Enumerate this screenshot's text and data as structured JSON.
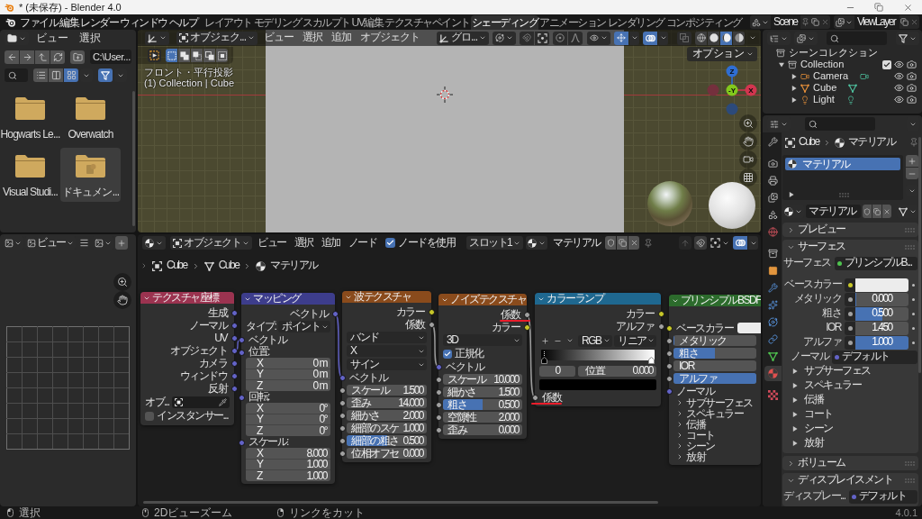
{
  "window": {
    "title": "* (未保存) - Blender 4.0"
  },
  "top_bar": {
    "menus": [
      "ファイル",
      "編集",
      "レンダー",
      "ウィンドウ",
      "ヘルプ"
    ],
    "workspaces": [
      {
        "label": "レイアウト",
        "selected": false
      },
      {
        "label": "モデリング",
        "selected": false
      },
      {
        "label": "スカルプト",
        "selected": false
      },
      {
        "label": "UV編集",
        "selected": false
      },
      {
        "label": "テクスチャペイント",
        "selected": false
      },
      {
        "label": "シェーディング",
        "selected": true
      },
      {
        "label": "アニメーション",
        "selected": false
      },
      {
        "label": "レンダリング",
        "selected": false
      },
      {
        "label": "コンポジティング",
        "selected": false
      }
    ],
    "scene": "Scene",
    "view_layer": "ViewLayer"
  },
  "file_browser": {
    "menus": [
      "ビュー",
      "選択"
    ],
    "path": "C:\\User...",
    "display_modes": [
      {
        "kind": "list",
        "selected": false
      },
      {
        "kind": "columns",
        "selected": false
      },
      {
        "kind": "thumbnails",
        "selected": true
      }
    ],
    "filter": {
      "on": true
    },
    "items": [
      {
        "name": "Hogwarts Le...",
        "kind": "folder",
        "selected": false
      },
      {
        "name": "Overwatch",
        "kind": "folder",
        "selected": false
      },
      {
        "name": "Visual Studi...",
        "kind": "folder",
        "selected": false
      },
      {
        "name": "ドキュメン...",
        "kind": "documents",
        "selected": true
      }
    ]
  },
  "viewport": {
    "mode": "オブジェク...",
    "menus": [
      "ビュー",
      "選択",
      "追加",
      "オブジェクト"
    ],
    "orientation": "グロ...",
    "toggles": [
      {
        "kind": "gizmos",
        "on": true
      },
      {
        "kind": "overlays",
        "on": true
      },
      {
        "kind": "xray",
        "on": false
      }
    ],
    "shading_modes": [
      {
        "kind": "wireframe",
        "selected": false
      },
      {
        "kind": "solid",
        "selected": false
      },
      {
        "kind": "material",
        "selected": true
      },
      {
        "kind": "rendered",
        "selected": false
      }
    ],
    "select_modes": [
      {
        "kind": "set",
        "selected": true
      },
      {
        "kind": "extend",
        "selected": false
      },
      {
        "kind": "subtract",
        "selected": false
      },
      {
        "kind": "invert",
        "selected": false
      },
      {
        "kind": "intersect",
        "selected": false
      }
    ],
    "view_name": "フロント・平行投影",
    "collection_info": "(1) Collection | Cube",
    "options": "オプション",
    "gizmo": {
      "z": "Z",
      "y": "-Y",
      "x": "X"
    }
  },
  "outliner": {
    "items": [
      {
        "name": "シーンコレクション",
        "kind": "scene",
        "children": [
          {
            "name": "Collection",
            "kind": "collection",
            "expanded": true,
            "checked": true,
            "children": [
              {
                "name": "Camera",
                "kind": "camera",
                "expanded": false
              },
              {
                "name": "Cube",
                "kind": "mesh",
                "expanded": false
              },
              {
                "name": "Light",
                "kind": "light",
                "expanded": false
              }
            ]
          }
        ]
      }
    ]
  },
  "properties": {
    "tabs": [
      {
        "kind": "tool",
        "selected": false
      },
      {
        "kind": "render",
        "selected": false
      },
      {
        "kind": "output",
        "selected": false
      },
      {
        "kind": "view_layer",
        "selected": false
      },
      {
        "kind": "scene",
        "selected": false
      },
      {
        "kind": "world",
        "selected": false
      },
      {
        "kind": "collection",
        "selected": false
      },
      {
        "kind": "object",
        "selected": false
      },
      {
        "kind": "modifiers",
        "selected": false
      },
      {
        "kind": "particles",
        "selected": false
      },
      {
        "kind": "physics",
        "selected": false
      },
      {
        "kind": "constraints",
        "selected": false
      },
      {
        "kind": "data",
        "selected": false
      },
      {
        "kind": "material",
        "selected": true
      },
      {
        "kind": "texture",
        "selected": false
      }
    ],
    "breadcrumbs": [
      {
        "kind": "object",
        "label": "Cube"
      },
      {
        "kind": "material",
        "label": "マテリアル"
      }
    ],
    "slots": [
      {
        "name": "マテリアル",
        "selected": true
      }
    ],
    "material": "マテリアル",
    "panels": [
      {
        "title": "プレビュー",
        "expanded": false
      },
      {
        "title": "サーフェス",
        "expanded": true,
        "rows": [
          {
            "kind": "link",
            "label": "サーフェス",
            "value": "プリンシプルB...",
            "socket": {
              "color": "#4fc34f"
            }
          },
          {
            "kind": "color",
            "label": "ベースカラー",
            "socket": {
              "color": "#c7c729"
            },
            "color": "#ececec"
          },
          {
            "kind": "slider",
            "label": "メタリック",
            "value": "0.000",
            "socket": {
              "color": "#a1a1a1"
            },
            "level": 0
          },
          {
            "kind": "slider",
            "label": "粗さ",
            "value": "0.500",
            "socket": {
              "color": "#a1a1a1"
            },
            "level": 0.5
          },
          {
            "kind": "number",
            "label": "IOR",
            "value": "1.450",
            "socket": {
              "color": "#a1a1a1"
            }
          },
          {
            "kind": "slider",
            "label": "アルファ",
            "value": "1.000",
            "socket": {
              "color": "#a1a1a1"
            },
            "level": 1
          },
          {
            "kind": "link",
            "label": "ノーマル",
            "value": "デフォルト",
            "socket": {
              "color": "#6363c7"
            }
          },
          {
            "kind": "subpanel",
            "label": "サブサーフェス",
            "expanded": false
          },
          {
            "kind": "subpanel",
            "label": "スペキュラー",
            "expanded": false
          },
          {
            "kind": "subpanel",
            "label": "伝播",
            "expanded": false
          },
          {
            "kind": "subpanel",
            "label": "コート",
            "expanded": false
          },
          {
            "kind": "subpanel",
            "label": "シーン",
            "expanded": false
          },
          {
            "kind": "subpanel",
            "label": "放射",
            "expanded": false
          }
        ]
      },
      {
        "title": "ボリューム",
        "expanded": false
      },
      {
        "title": "ディスプレイスメント",
        "expanded": true,
        "rows": [
          {
            "kind": "link",
            "label": "ディスプレー...",
            "value": "デフォルト",
            "socket": {
              "color": "#6363c7"
            }
          }
        ]
      }
    ]
  },
  "image_editor": {
    "view_menu": "ビュー"
  },
  "node_editor": {
    "object_mode": "オブジェクト",
    "menus": [
      "ビュー",
      "選択",
      "追加",
      "ノード"
    ],
    "use_nodes": {
      "label": "ノードを使用",
      "checked": true
    },
    "slot": "スロット1",
    "material": "マテリアル",
    "overlays": {
      "on": true
    },
    "breadcrumbs": [
      {
        "kind": "object",
        "label": "Cube"
      },
      {
        "kind": "mesh",
        "label": "Cube"
      },
      {
        "kind": "material",
        "label": "マテリアル"
      }
    ],
    "nodes": [
      {
        "title": "テクスチャ座標",
        "color": "#9b3350",
        "rows": [
          {
            "kind": "output",
            "label": "生成",
            "socket": {
              "color": "#6363c7"
            }
          },
          {
            "kind": "output",
            "label": "ノーマル",
            "socket": {
              "color": "#6363c7"
            }
          },
          {
            "kind": "output",
            "label": "UV",
            "socket": {
              "color": "#6363c7"
            }
          },
          {
            "kind": "output",
            "label": "オブジェクト",
            "socket": {
              "color": "#6363c7"
            }
          },
          {
            "kind": "output",
            "label": "カメラ",
            "socket": {
              "color": "#6363c7"
            }
          },
          {
            "kind": "output",
            "label": "ウィンドウ",
            "socket": {
              "color": "#6363c7"
            }
          },
          {
            "kind": "output",
            "label": "反射",
            "socket": {
              "color": "#6363c7"
            }
          },
          {
            "kind": "object",
            "label": "オブ..."
          },
          {
            "kind": "checkbox",
            "label": "インスタンサー...",
            "checked": false
          }
        ]
      },
      {
        "title": "マッピング",
        "color": "#3d3d8c",
        "rows": [
          {
            "kind": "output",
            "label": "ベクトル",
            "socket": {
              "color": "#6363c7"
            }
          },
          {
            "kind": "dropdown",
            "label": "タイプ:",
            "value": "ポイント"
          },
          {
            "kind": "input",
            "label": "ベクトル",
            "socket": {
              "color": "#6363c7"
            }
          },
          {
            "kind": "vector",
            "label": "位置:",
            "socket": {
              "color": "#6363c7"
            },
            "components": [
              {
                "axis": "X",
                "value": "0 m"
              },
              {
                "axis": "Y",
                "value": "0 m"
              },
              {
                "axis": "Z",
                "value": "0 m"
              }
            ]
          },
          {
            "kind": "vector",
            "label": "回転:",
            "socket": {
              "color": "#6363c7"
            },
            "components": [
              {
                "axis": "X",
                "value": "0°"
              },
              {
                "axis": "Y",
                "value": "0°"
              },
              {
                "axis": "Z",
                "value": "0°"
              }
            ]
          },
          {
            "kind": "vector",
            "label": "スケール:",
            "socket": {
              "color": "#6363c7"
            },
            "components": [
              {
                "axis": "X",
                "value": "8.000"
              },
              {
                "axis": "Y",
                "value": "1.000"
              },
              {
                "axis": "Z",
                "value": "1.000"
              }
            ]
          }
        ]
      },
      {
        "title": "波テクスチャ",
        "color": "#8a4b1c",
        "rows": [
          {
            "kind": "output",
            "label": "カラー",
            "socket": {
              "color": "#c7c729"
            }
          },
          {
            "kind": "output",
            "label": "係数",
            "socket": {
              "color": "#a1a1a1"
            }
          },
          {
            "kind": "dropdown",
            "value": "バンド"
          },
          {
            "kind": "dropdown",
            "value": "X"
          },
          {
            "kind": "dropdown",
            "value": "サイン"
          },
          {
            "kind": "input",
            "label": "ベクトル",
            "socket": {
              "color": "#6363c7"
            }
          },
          {
            "kind": "number",
            "label": "スケール",
            "value": "1.500",
            "socket": {
              "color": "#a1a1a1"
            }
          },
          {
            "kind": "number",
            "label": "歪み",
            "value": "14.000",
            "socket": {
              "color": "#a1a1a1"
            }
          },
          {
            "kind": "number",
            "label": "細かさ",
            "value": "2.000",
            "socket": {
              "color": "#a1a1a1"
            }
          },
          {
            "kind": "number",
            "label": "細部のスケ",
            "value": "1.000",
            "socket": {
              "color": "#a1a1a1"
            }
          },
          {
            "kind": "slider",
            "label": "細部の粗さ",
            "value": "0.500",
            "socket": {
              "color": "#a1a1a1"
            },
            "level": 0.5
          },
          {
            "kind": "number",
            "label": "位相オフセ",
            "value": "0.000",
            "socket": {
              "color": "#a1a1a1"
            }
          }
        ]
      },
      {
        "title": "ノイズテクスチャ",
        "color": "#8a4b1c",
        "rows": [
          {
            "kind": "output",
            "label": "係数",
            "socket": {
              "color": "#a1a1a1"
            },
            "underlined": true
          },
          {
            "kind": "output",
            "label": "カラー",
            "socket": {
              "color": "#c7c729"
            }
          },
          {
            "kind": "dropdown",
            "value": "3D"
          },
          {
            "kind": "checkbox",
            "label": "正規化",
            "checked": true
          },
          {
            "kind": "input",
            "label": "ベクトル",
            "socket": {
              "color": "#6363c7"
            }
          },
          {
            "kind": "number",
            "label": "スケール",
            "value": "10.000",
            "socket": {
              "color": "#a1a1a1"
            }
          },
          {
            "kind": "number",
            "label": "細かさ",
            "value": "1.500",
            "socket": {
              "color": "#a1a1a1"
            }
          },
          {
            "kind": "slider",
            "label": "粗さ",
            "value": "0.500",
            "socket": {
              "color": "#a1a1a1"
            },
            "level": 0.5
          },
          {
            "kind": "number",
            "label": "空隙性",
            "value": "2.000",
            "socket": {
              "color": "#a1a1a1"
            }
          },
          {
            "kind": "number",
            "label": "歪み",
            "value": "0.000",
            "socket": {
              "color": "#a1a1a1"
            }
          }
        ]
      },
      {
        "title": "カラーランプ",
        "color": "#1f6890",
        "rows": [
          {
            "kind": "output",
            "label": "カラー",
            "socket": {
              "color": "#c7c729"
            }
          },
          {
            "kind": "output",
            "label": "アルファ",
            "socket": {
              "color": "#a1a1a1"
            }
          },
          {
            "kind": "ramp_controls",
            "color_mode": "RGB",
            "interpolation": "リニア"
          },
          {
            "kind": "gradient",
            "stops": [
              {
                "color": "#000000",
                "selected": true
              },
              {
                "color": "#ffffff",
                "selected": false
              }
            ]
          },
          {
            "kind": "ramp_stop",
            "active_stop": "0",
            "label": "位置",
            "value": "0.000"
          },
          {
            "kind": "swatch",
            "color": "#000000"
          },
          {
            "kind": "input",
            "label": "係数",
            "socket": {
              "color": "#a1a1a1"
            },
            "underlined": true
          }
        ]
      },
      {
        "title": "プリンシプルBSDF",
        "color": "#2c6b2c",
        "rows": [
          {
            "kind": "color",
            "label": "ベースカラー",
            "socket": {
              "color": "#c7c729"
            },
            "color": "#ececec"
          },
          {
            "kind": "slider",
            "label": "メタリック",
            "socket": {
              "color": "#a1a1a1"
            },
            "level": 0
          },
          {
            "kind": "slider",
            "label": "粗さ",
            "socket": {
              "color": "#a1a1a1"
            },
            "level": 0.5
          },
          {
            "kind": "number",
            "label": "IOR",
            "socket": {
              "color": "#a1a1a1"
            }
          },
          {
            "kind": "slider",
            "label": "アルファ",
            "socket": {
              "color": "#a1a1a1"
            },
            "level": 1
          },
          {
            "kind": "input",
            "label": "ノーマル",
            "socket": {
              "color": "#6363c7"
            }
          },
          {
            "kind": "panel",
            "label": "サブサーフェス",
            "expanded": false
          },
          {
            "kind": "panel",
            "label": "スペキュラー",
            "expanded": false
          },
          {
            "kind": "panel",
            "label": "伝播",
            "expanded": false
          },
          {
            "kind": "panel",
            "label": "コート",
            "expanded": false
          },
          {
            "kind": "panel",
            "label": "シーン",
            "expanded": false
          },
          {
            "kind": "panel",
            "label": "放射",
            "expanded": false
          }
        ]
      }
    ]
  },
  "status_bar": {
    "hints": [
      {
        "kind": "left",
        "label": "選択"
      },
      {
        "kind": "middle",
        "label": "2Dビューズーム"
      },
      {
        "kind": "right",
        "label": "リンクをカット"
      }
    ],
    "version": "4.0.1"
  }
}
